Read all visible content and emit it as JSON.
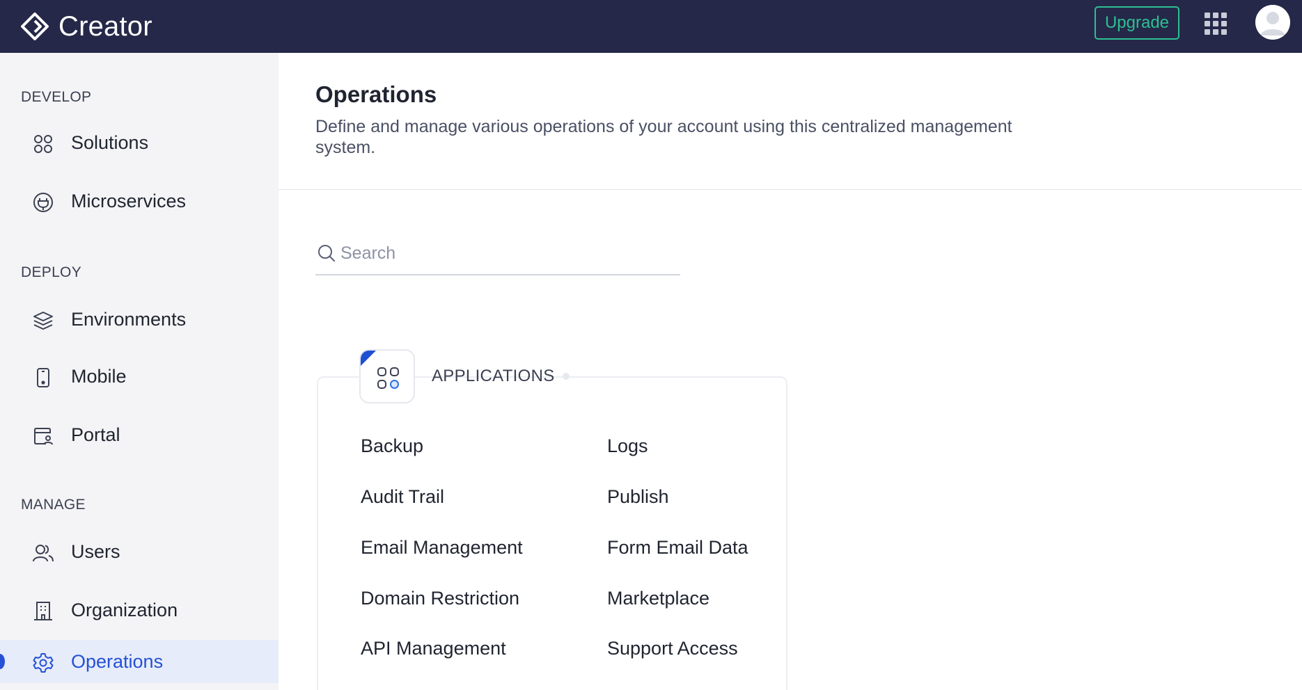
{
  "header": {
    "app_name": "Creator",
    "logo_icon": "creator-logo-icon",
    "upgrade_label": "Upgrade",
    "apps_icon": "app-grid-icon",
    "avatar_icon": "user-avatar-icon",
    "colors": {
      "background": "#252848",
      "upgrade_accent": "#2dbf94"
    }
  },
  "sidebar": {
    "sections": [
      {
        "title": "DEVELOP",
        "items": [
          {
            "label": "Solutions",
            "icon": "solutions-grid-icon"
          },
          {
            "label": "Microservices",
            "icon": "plug-icon"
          }
        ]
      },
      {
        "title": "DEPLOY",
        "items": [
          {
            "label": "Environments",
            "icon": "layers-icon"
          },
          {
            "label": "Mobile",
            "icon": "mobile-icon"
          },
          {
            "label": "Portal",
            "icon": "portal-icon"
          }
        ]
      },
      {
        "title": "MANAGE",
        "items": [
          {
            "label": "Users",
            "icon": "users-icon"
          },
          {
            "label": "Organization",
            "icon": "building-icon"
          },
          {
            "label": "Operations",
            "icon": "gear-icon",
            "active": true
          }
        ]
      }
    ],
    "colors": {
      "background": "#f4f4f6",
      "active_background": "#e7ecfa",
      "active_text": "#2451d6"
    }
  },
  "main": {
    "title": "Operations",
    "description": "Define and manage various operations of your account using this centralized management system.",
    "search": {
      "placeholder": "Search",
      "value": "",
      "icon": "search-icon"
    },
    "card": {
      "title": "APPLICATIONS",
      "icon": "applications-icon",
      "items": [
        [
          "Backup",
          "Logs"
        ],
        [
          "Audit Trail",
          "Publish"
        ],
        [
          "Email Management",
          "Form Email Data"
        ],
        [
          "Domain Restriction",
          "Marketplace"
        ],
        [
          "API Management",
          "Support Access"
        ]
      ]
    }
  }
}
